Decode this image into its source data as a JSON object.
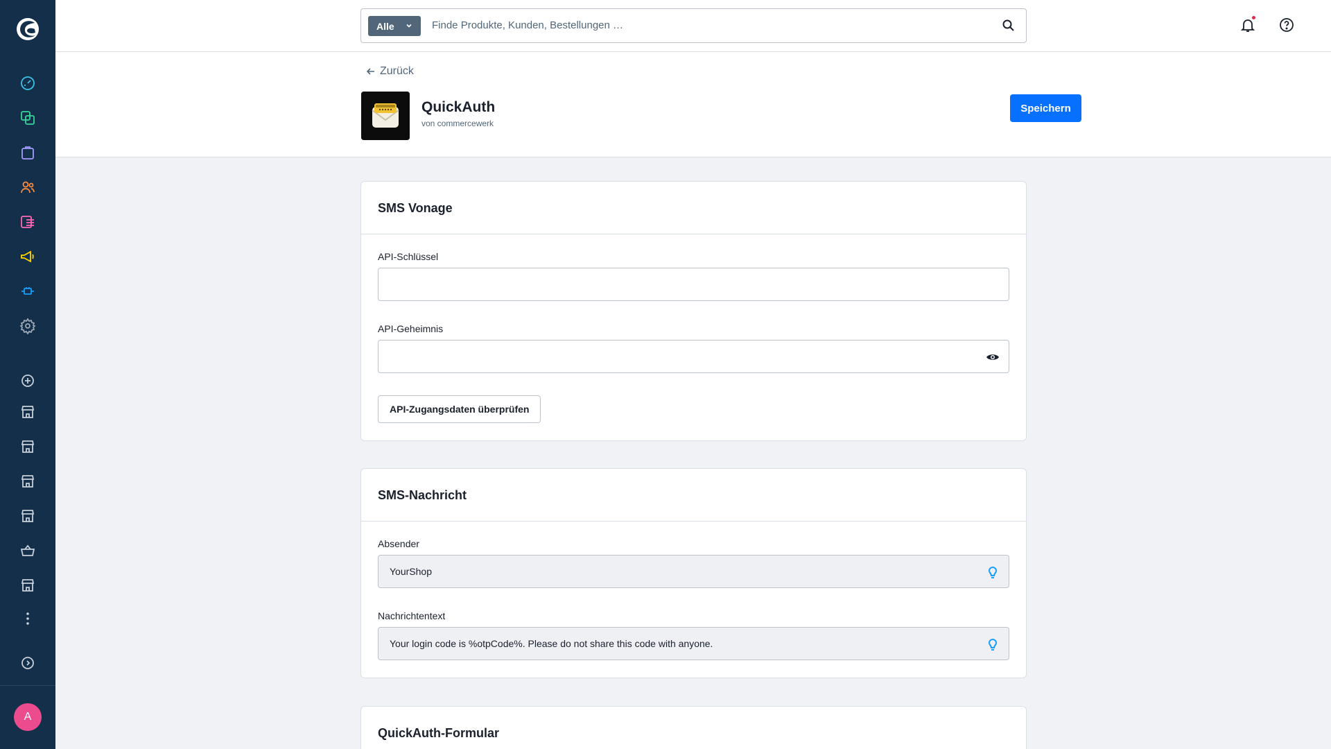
{
  "sidebar": {
    "avatar_initial": "A",
    "nav_icons": [
      "dashboard-icon",
      "catalog-icon",
      "orders-icon",
      "customers-icon",
      "content-icon",
      "marketing-icon",
      "extensions-icon",
      "settings-icon"
    ],
    "sales_channel_icons": [
      "add-sales-channel-icon",
      "storefront-icon",
      "storefront-icon",
      "storefront-icon",
      "storefront-icon",
      "basket-icon",
      "storefront-icon"
    ]
  },
  "search": {
    "scope_label": "Alle",
    "placeholder": "Finde Produkte, Kunden, Bestellungen …"
  },
  "header": {
    "back_label": "Zurück",
    "app_name": "QuickAuth",
    "vendor": "von commercewerk",
    "save_label": "Speichern"
  },
  "cards": {
    "sms_vonage": {
      "title": "SMS Vonage",
      "api_key_label": "API-Schlüssel",
      "api_key_value": "",
      "api_secret_label": "API-Geheimnis",
      "api_secret_value": "",
      "check_button_label": "API-Zugangsdaten überprüfen"
    },
    "sms_message": {
      "title": "SMS-Nachricht",
      "sender_label": "Absender",
      "sender_value": "YourShop",
      "text_label": "Nachrichtentext",
      "text_value": "Your login code is %otpCode%. Please do not share this code with anyone."
    },
    "quickauth_form": {
      "title": "QuickAuth-Formular"
    }
  },
  "colors": {
    "sidebar_bg": "#142f4a",
    "primary": "#0870ff",
    "avatar": "#ec4b8e",
    "notification_dot": "#de294c"
  }
}
